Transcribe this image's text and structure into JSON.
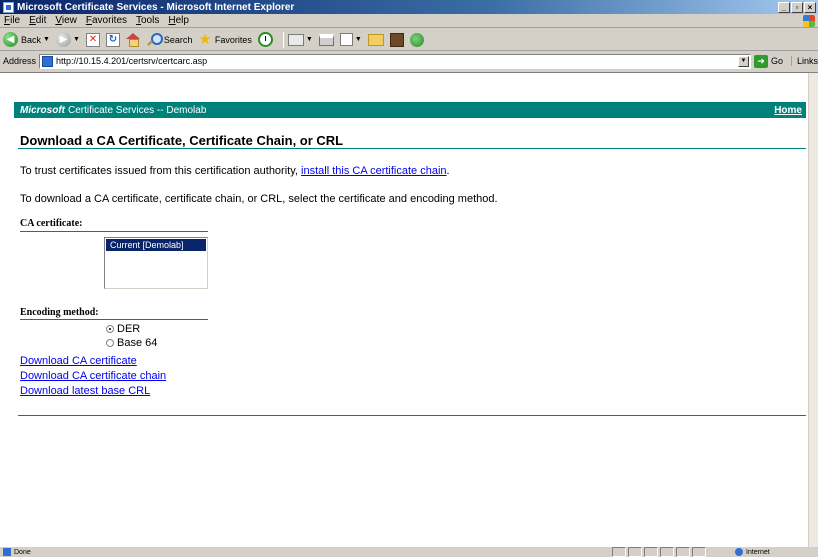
{
  "window": {
    "title": "Microsoft Certificate Services - Microsoft Internet Explorer",
    "minimize": "_",
    "restore": "▫",
    "close": "×"
  },
  "menu": [
    "File",
    "Edit",
    "View",
    "Favorites",
    "Tools",
    "Help"
  ],
  "toolbar": {
    "back_label": "Back",
    "search_label": "Search",
    "favorites_label": "Favorites"
  },
  "address": {
    "label": "Address",
    "url": "http://10.15.4.201/certsrv/certcarc.asp",
    "go_label": "Go",
    "links_label": "Links"
  },
  "page": {
    "brand": "Microsoft",
    "header_title": "Certificate Services -- Demolab",
    "home_link": "Home",
    "title": "Download a CA Certificate, Certificate Chain, or CRL",
    "trust_text": "To trust certificates issued from this certification authority, ",
    "trust_link": "install this CA certificate chain",
    "trust_suffix": ".",
    "instructions": "To download a CA certificate, certificate chain, or CRL, select the certificate and encoding method.",
    "ca_cert_label": "CA certificate:",
    "ca_cert_options": [
      "Current [Demolab]"
    ],
    "encoding_label": "Encoding method:",
    "encoding_options": [
      {
        "label": "DER",
        "checked": true
      },
      {
        "label": "Base 64",
        "checked": false
      }
    ],
    "links": [
      "Download CA certificate",
      "Download CA certificate chain",
      "Download latest base CRL"
    ]
  },
  "status": {
    "text": "Done",
    "zone": "Internet"
  },
  "colors": {
    "accent": "#00827b",
    "link": "#0000ee",
    "selection": "#0a246a"
  }
}
